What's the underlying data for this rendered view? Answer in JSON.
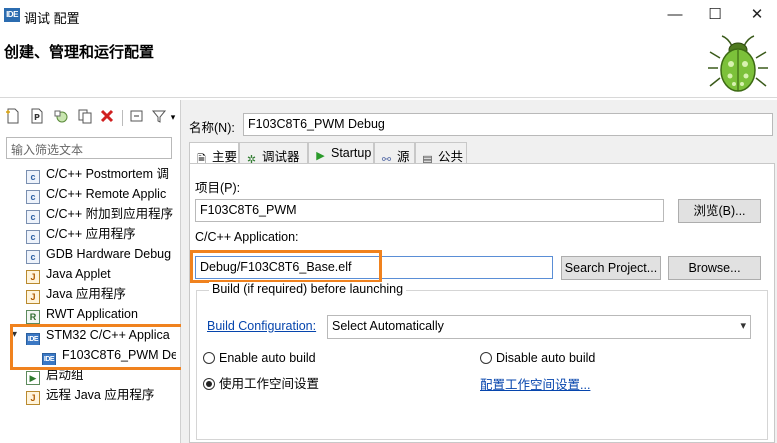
{
  "window": {
    "app_icon_text": "IDE",
    "title": "调试 配置",
    "minimize_glyph": "—",
    "maximize_glyph": "☐",
    "close_glyph": "✕"
  },
  "header": {
    "title": "创建、管理和运行配置"
  },
  "left": {
    "filter_placeholder": "输入筛选文本",
    "tree": [
      {
        "label": "C/C++ Postmortem 调",
        "icon": "c-icon"
      },
      {
        "label": "C/C++ Remote Applic",
        "icon": "c-icon"
      },
      {
        "label": "C/C++ 附加到应用程序",
        "icon": "c-icon"
      },
      {
        "label": "C/C++ 应用程序",
        "icon": "c-icon"
      },
      {
        "label": "GDB Hardware Debug",
        "icon": "c-icon"
      },
      {
        "label": "Java Applet",
        "icon": "java-applet-icon"
      },
      {
        "label": "Java 应用程序",
        "icon": "java-icon"
      },
      {
        "label": "RWT Application",
        "icon": "rwt-icon"
      },
      {
        "label": "STM32 C/C++ Applica",
        "icon": "ide-icon"
      },
      {
        "label": "F103C8T6_PWM De",
        "icon": "ide-icon"
      },
      {
        "label": "启动组",
        "icon": "launch-group-icon"
      },
      {
        "label": "远程 Java 应用程序",
        "icon": "remote-java-icon"
      }
    ]
  },
  "right": {
    "name_label": "名称(N):",
    "name_value": "F103C8T6_PWM Debug",
    "tabs": [
      {
        "label": "主要",
        "icon": "main-tab-icon"
      },
      {
        "label": "调试器",
        "icon": "debugger-icon"
      },
      {
        "label": "Startup",
        "icon": "startup-icon"
      },
      {
        "label": "源",
        "icon": "source-icon"
      },
      {
        "label": "公共",
        "icon": "common-icon"
      }
    ],
    "project_label": "项目(P):",
    "project_value": "F103C8T6_PWM",
    "browse_button": "浏览(B)...",
    "app_label": "C/C++ Application:",
    "app_value": "Debug/F103C8T6_Base.elf",
    "search_project_button": "Search Project...",
    "browse_en_button": "Browse...",
    "build_group_title": "Build (if required) before launching",
    "build_config_link": "Build Configuration:",
    "build_config_value": "Select Automatically",
    "enable_auto_build": "Enable auto build",
    "disable_auto_build": "Disable auto build",
    "use_workspace": "使用工作空间设置",
    "configure_workspace_link": "配置工作空间设置...",
    "highlight_color": "#f0821e"
  }
}
